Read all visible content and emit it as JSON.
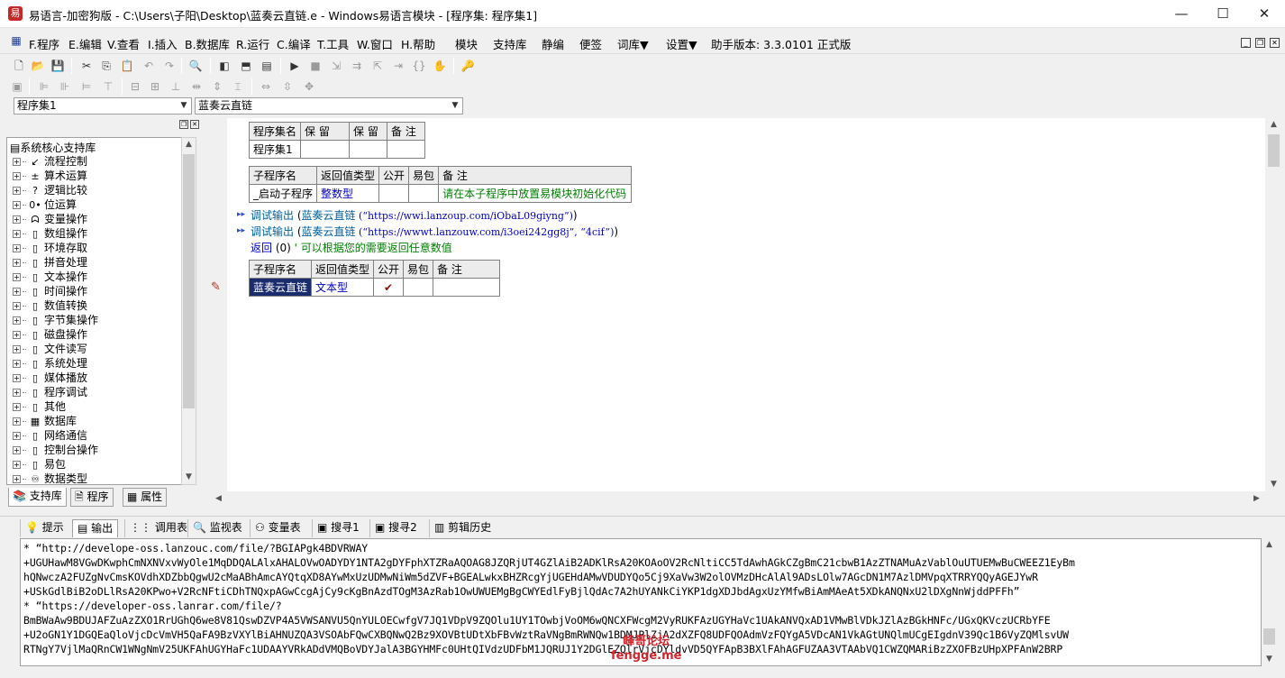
{
  "window": {
    "title": "易语言-加密狗版 - C:\\Users\\子阳\\Desktop\\蓝奏云直链.e - Windows易语言模块 - [程序集: 程序集1]",
    "minimize": "—",
    "maximize": "☐",
    "close": "✕"
  },
  "menu": {
    "items": [
      "F.程序",
      "E.编辑",
      "V.查看",
      "I.插入",
      "B.数据库",
      "R.运行",
      "C.编译",
      "T.工具",
      "W.窗口",
      "H.帮助",
      "模块",
      "支持库",
      "静编",
      "便签",
      "词库▼",
      "设置▼"
    ],
    "version": "助手版本: 3.3.0101 正式版"
  },
  "combos": {
    "left": "程序集1",
    "right": "蓝奏云直链"
  },
  "tree": {
    "root": "系统核心支持库",
    "items": [
      {
        "label": "流程控制",
        "icon": "arrow-icon"
      },
      {
        "label": "算术运算",
        "icon": "math-icon"
      },
      {
        "label": "逻辑比较",
        "icon": "question-icon"
      },
      {
        "label": "位运算",
        "icon": "bit-icon"
      },
      {
        "label": "变量操作",
        "icon": "variable-icon"
      },
      {
        "label": "数组操作",
        "icon": "folder-icon"
      },
      {
        "label": "环境存取",
        "icon": "folder-icon"
      },
      {
        "label": "拼音处理",
        "icon": "folder-icon"
      },
      {
        "label": "文本操作",
        "icon": "folder-icon"
      },
      {
        "label": "时间操作",
        "icon": "folder-icon"
      },
      {
        "label": "数值转换",
        "icon": "folder-icon"
      },
      {
        "label": "字节集操作",
        "icon": "folder-icon"
      },
      {
        "label": "磁盘操作",
        "icon": "folder-icon"
      },
      {
        "label": "文件读写",
        "icon": "folder-icon"
      },
      {
        "label": "系统处理",
        "icon": "folder-icon"
      },
      {
        "label": "媒体播放",
        "icon": "folder-icon"
      },
      {
        "label": "程序调试",
        "icon": "folder-icon"
      },
      {
        "label": "其他",
        "icon": "folder-icon"
      },
      {
        "label": "数据库",
        "icon": "grid-icon"
      },
      {
        "label": "网络通信",
        "icon": "folder-icon"
      },
      {
        "label": "控制台操作",
        "icon": "folder-icon"
      },
      {
        "label": "易包",
        "icon": "folder-icon"
      },
      {
        "label": "数据类型",
        "icon": "datatype-icon"
      }
    ]
  },
  "left_tabs": [
    "支持库",
    "程序",
    "属性"
  ],
  "editor": {
    "set_table": {
      "headers": [
        "程序集名",
        "保 留",
        "保 留",
        "备 注"
      ],
      "row": [
        "程序集1",
        "",
        "",
        ""
      ]
    },
    "sub1_table": {
      "headers": [
        "子程序名",
        "返回值类型",
        "公开",
        "易包",
        "备 注"
      ],
      "row": [
        "_启动子程序",
        "整数型",
        "",
        "",
        "请在本子程序中放置易模块初始化代码"
      ]
    },
    "code_lines": [
      {
        "fn": "调试输出",
        "open": " (",
        "call": "蓝奏云直链",
        "args": " (“https://wwi.lanzoup.com/iObaL09giyng”)",
        "close": ")"
      },
      {
        "fn": "调试输出",
        "open": " (",
        "call": "蓝奏云直链",
        "args": " (“https://wwwt.lanzouw.com/i3oei242gg8j”, “4cif”)",
        "close": ")"
      }
    ],
    "return_line": {
      "kw": "返回",
      "val": " (0) ",
      "comment": "' 可以根据您的需要返回任意数值"
    },
    "sub2_table": {
      "headers": [
        "子程序名",
        "返回值类型",
        "公开",
        "易包",
        "备 注"
      ],
      "row": [
        "蓝奏云直链",
        "文本型",
        "✔",
        "",
        ""
      ]
    },
    "gutter_plus": "+"
  },
  "bottom_tabs": [
    "提示",
    "输出",
    "调用表",
    "监视表",
    "变量表",
    "搜寻1",
    "搜寻2",
    "剪辑历史"
  ],
  "output_lines": [
    "*  “http://develope-oss.lanzouc.com/file/?BGIAPgk4BDVRWAY",
    "+UGUHawM8VGwDKwphCmNXNVxvWyOle1MqDDQALAlxAHALOVwOADYDY1NTA2gDYFphXTZRaAQOAG8JZQRjUT4GZlAiB2ADKlRsA20KOAoOV2RcNltiCC5TdAwhAGkCZgBmC21cbwB1AzZTNAMuAzVablOuUTUEMwBuCWEEZ1EyBm",
    "hQNwczA2FUZgNvCmsKOVdhXDZbbQgwU2cMaABhAmcAYQtqXD8AYwMxUzUDMwNiWm5dZVF+BGEALwkxBHZRcgYjUGEHdAMwVDUDYQo5Cj9XaVw3W2olOVMzDHcAlAl9ADsLOlw7AGcDN1M7AzlDMVpqXTRRYQQyAGEJYwR",
    "+USkGdlBiB2oDLlRsA20KPwo+V2RcNFtiCDhTNQxpAGwCcgAjCy9cKgBnAzdTOgM3AzRab1OwUWUEMgBgCWYEdlFyBjlQdAc7A2hUYANkCiYKP1dgXDJbdAgxUzYMfwBiAmMAeAt5XDkANQNxU2lDXgNnWjddPFFh”",
    "*  “https://developer-oss.lanrar.com/file/?",
    "BmBWaAw9BDUJAFZuAzZXO1RrUGhQ6we8V81QswDZVP4A5VWSANVU5QnYULOECwfgV7JQ1VDpV9ZQOlu1UY1TOwbjVoOM6wQNCXFWcgM2VyRUKFAzUGYHaVc1UAkANVQxAD1VMwBlVDkJZlAzBGkHNFc/UGxQKVczUCRbYFE",
    "+U2oGN1Y1DGQEaQloVjcDcVmVH5QaFA9BzVXYlBiAHNUZQA3VSOAbFQwCXBQNwQ2Bz9XOVBtUDtXbFBvWztRaVNgBmRWNQw1BDMJPlZjA2dXZFQ8UDFQOAdmVzFQYgA5VDcAN1VkAGtUNQlmUCgEIgdnV39Qc1B6VyZQMlsvUW",
    "RTNgY7VjlMaQRnCW1WNgNmV25UKFAhUGYHaFc1UDAAYVRkADdVMQBoVDYJalA3BGYHMFc0UHtQIVdzUDFbM1JQRUJ1Y2DGlEZQlrVjcDYldvVD5QYFApB3BXlFAhAGFUZAA3VTAAbVQ1CWZQMARiBzZXOFBzUHpXPFAnW2BRP"
  ],
  "watermark": {
    "line1": "峰哥论坛",
    "line2": "fengge.me"
  }
}
